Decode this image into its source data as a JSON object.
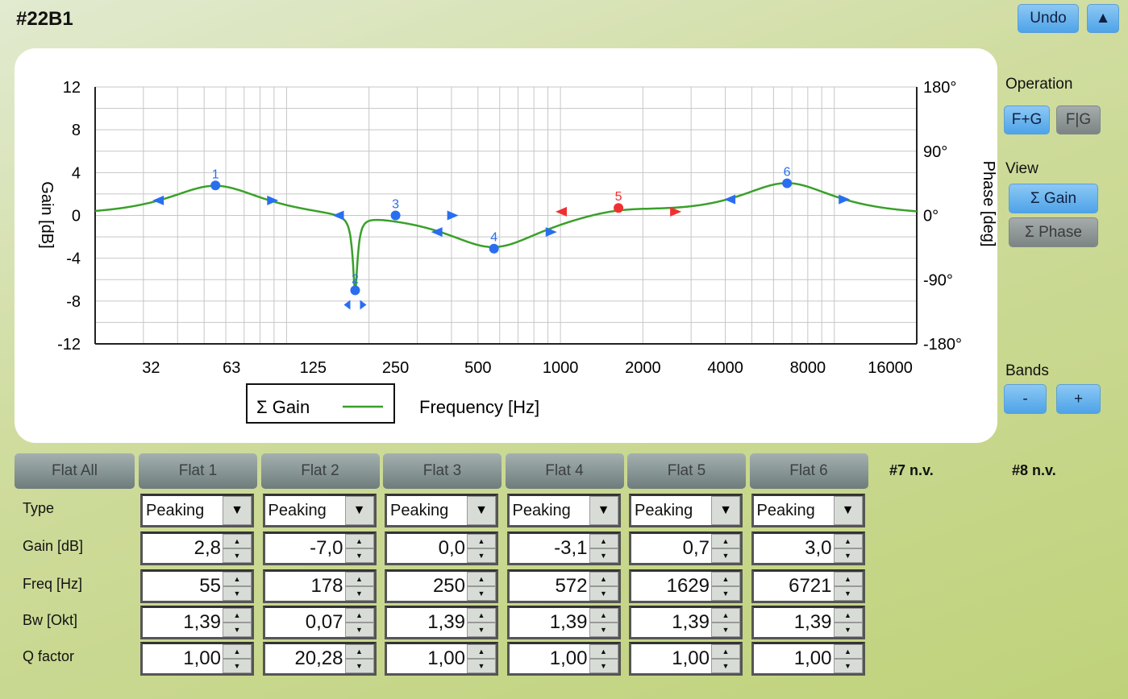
{
  "title": "#22B1",
  "top_buttons": {
    "undo": "Undo",
    "up": "▲"
  },
  "operation": {
    "label": "Operation",
    "f_plus_g": "F+G",
    "f_bar_g": "F|G"
  },
  "view": {
    "label": "View",
    "gain": "Σ Gain",
    "phase": "Σ Phase"
  },
  "bands_ctrl": {
    "label": "Bands",
    "minus": "-",
    "plus": "+"
  },
  "legend": {
    "series": "Σ Gain",
    "xlabel": "Frequency [Hz]"
  },
  "chart_data": {
    "type": "line",
    "ylabel": "Gain [dB]",
    "y2label": "Phase [deg]",
    "xlabel": "Frequency [Hz]",
    "xscale": "log",
    "xlim": [
      20,
      20000
    ],
    "ylim": [
      -12,
      12
    ],
    "xticks": [
      "32",
      "63",
      "125",
      "250",
      "500",
      "1000",
      "2000",
      "4000",
      "8000",
      "16000"
    ],
    "xtick_values": [
      32,
      63,
      125,
      250,
      500,
      1000,
      2000,
      4000,
      8000,
      16000
    ],
    "yticks": [
      "12",
      "8",
      "4",
      "0",
      "-4",
      "-8",
      "-12"
    ],
    "ytick_values": [
      12,
      8,
      4,
      0,
      -4,
      -8,
      -12
    ],
    "y2ticks": [
      "180°",
      "90°",
      "0°",
      "-90°",
      "-180°"
    ],
    "y2tick_values": [
      12,
      6,
      0,
      -6,
      -12
    ],
    "grid": true,
    "line_color": "#3aa02a",
    "bands": [
      {
        "id": "1",
        "freq": 55,
        "gain": 2.8,
        "q": 1.0,
        "bw": 1.39,
        "color": "#2a6ef0"
      },
      {
        "id": "2",
        "freq": 178,
        "gain": -7.0,
        "q": 20.28,
        "bw": 0.07,
        "color": "#2a6ef0"
      },
      {
        "id": "3",
        "freq": 250,
        "gain": 0.0,
        "q": 1.0,
        "bw": 1.39,
        "color": "#2a6ef0"
      },
      {
        "id": "4",
        "freq": 572,
        "gain": -3.1,
        "q": 1.0,
        "bw": 1.39,
        "color": "#2a6ef0"
      },
      {
        "id": "5",
        "freq": 1629,
        "gain": 0.7,
        "q": 1.0,
        "bw": 1.39,
        "color": "#f03030"
      },
      {
        "id": "6",
        "freq": 6721,
        "gain": 3.0,
        "q": 1.0,
        "bw": 1.39,
        "color": "#2a6ef0"
      }
    ]
  },
  "table": {
    "flat_all": "Flat All",
    "row_labels": [
      "Type",
      "Gain [dB]",
      "Freq [Hz]",
      "Bw [Okt]",
      "Q factor"
    ],
    "columns": [
      {
        "header": "Flat 1",
        "type": "Peaking",
        "gain": "2,8",
        "freq": "55",
        "bw": "1,39",
        "q": "1,00"
      },
      {
        "header": "Flat 2",
        "type": "Peaking",
        "gain": "-7,0",
        "freq": "178",
        "bw": "0,07",
        "q": "20,28"
      },
      {
        "header": "Flat 3",
        "type": "Peaking",
        "gain": "0,0",
        "freq": "250",
        "bw": "1,39",
        "q": "1,00"
      },
      {
        "header": "Flat 4",
        "type": "Peaking",
        "gain": "-3,1",
        "freq": "572",
        "bw": "1,39",
        "q": "1,00"
      },
      {
        "header": "Flat 5",
        "type": "Peaking",
        "gain": "0,7",
        "freq": "1629",
        "bw": "1,39",
        "q": "1,00"
      },
      {
        "header": "Flat 6",
        "type": "Peaking",
        "gain": "3,0",
        "freq": "6721",
        "bw": "1,39",
        "q": "1,00"
      }
    ],
    "unused": [
      "#7 n.v.",
      "#8 n.v."
    ]
  }
}
